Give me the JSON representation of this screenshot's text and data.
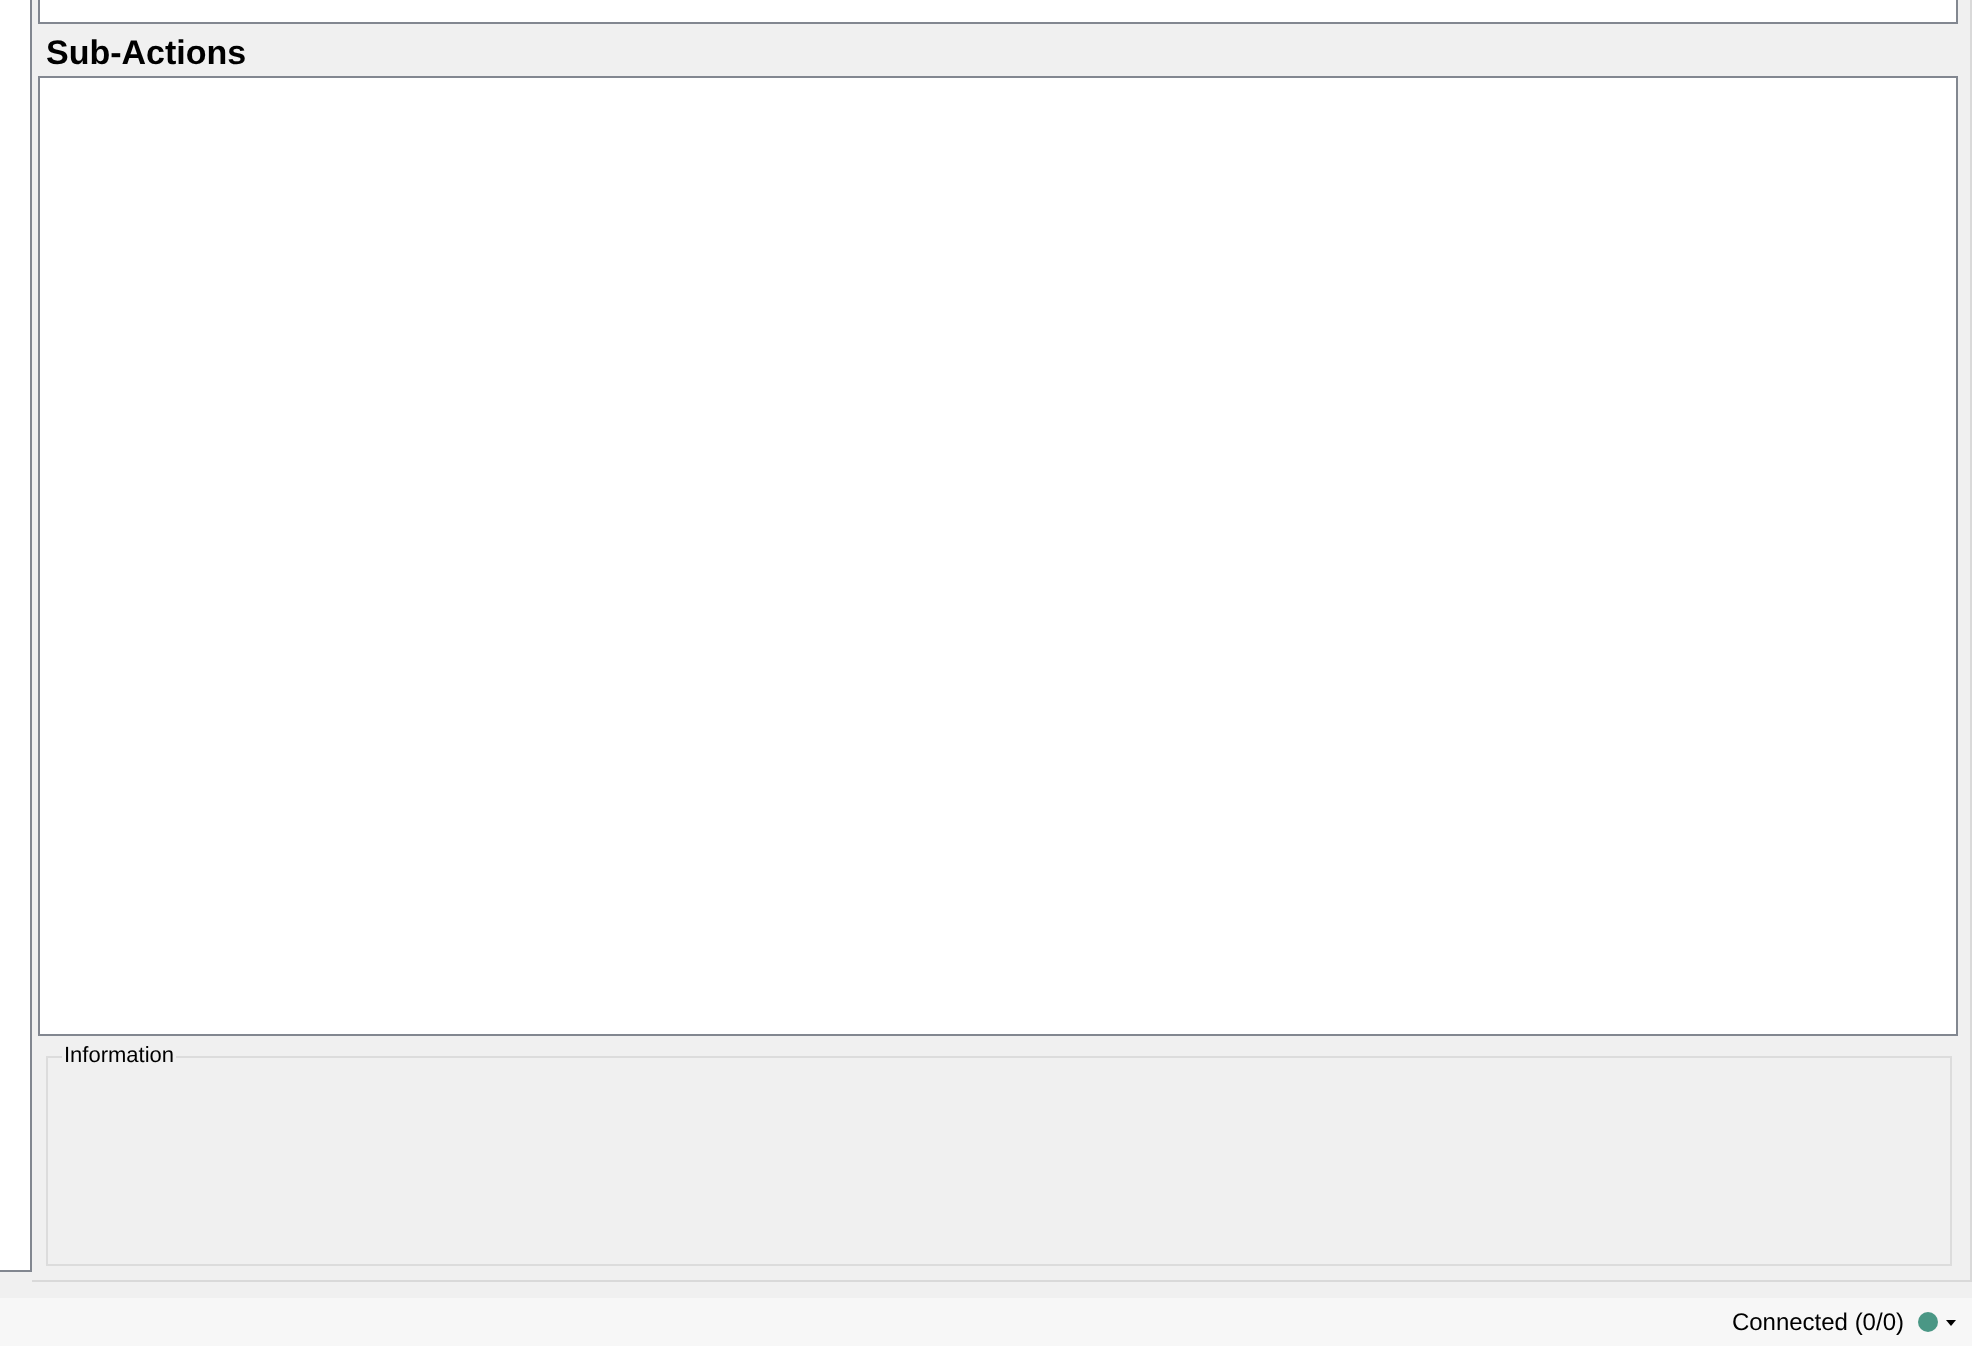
{
  "sub_actions": {
    "title": "Sub-Actions"
  },
  "information": {
    "title": "Information"
  },
  "status_bar": {
    "text": "Connected (0/0)",
    "color": "#4a9785"
  }
}
